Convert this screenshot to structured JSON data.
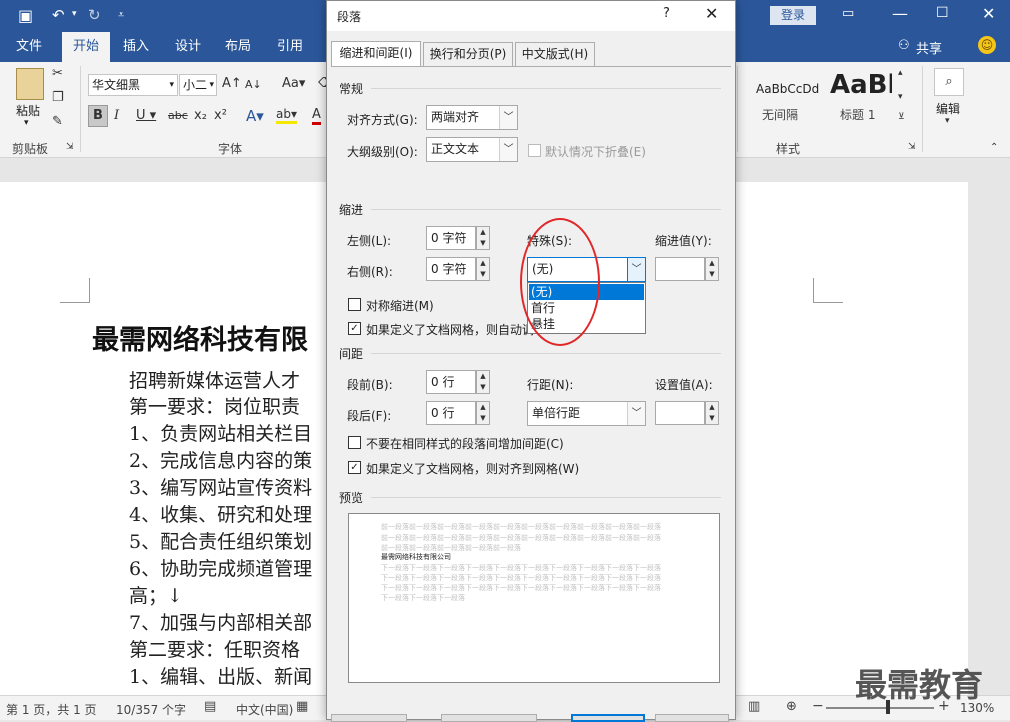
{
  "ribbon": {
    "tabs": [
      "文件",
      "开始",
      "插入",
      "设计",
      "布局",
      "引用"
    ],
    "login": "登录",
    "share": "共享",
    "font_name": "华文细黑",
    "font_size": "小二",
    "clipboard_label": "剪贴板",
    "font_group_label": "字体",
    "styles_label": "样式",
    "paste_label": "粘贴",
    "edit_label": "编辑",
    "style_nospacing_preview": "AaBbCcDd",
    "style_nospacing": "无间隔",
    "style_h1_preview": "AaBb",
    "style_h1": "标题 1"
  },
  "document": {
    "heading": "最需网络科技有限",
    "lines": [
      "招聘新媒体运营人才",
      "第一要求：岗位职责",
      "1、负责网站相关栏目",
      "2、完成信息内容的策",
      "3、编写网站宣传资料",
      "4、收集、研究和处理",
      "5、配合责任组织策划",
      "6、协助完成频道管理",
      "高；↓",
      "7、加强与内部相关部",
      "第二要求：任职资格",
      "1、编辑、出版、新闻"
    ]
  },
  "status": {
    "page": "第 1 页，共 1 页",
    "words": "10/357 个字",
    "lang": "中文(中国)",
    "zoom": "130%"
  },
  "dialog": {
    "title": "段落",
    "help": "?",
    "tabs": [
      "缩进和间距(I)",
      "换行和分页(P)",
      "中文版式(H)"
    ],
    "general": {
      "section": "常规",
      "align_label": "对齐方式(G):",
      "align_value": "两端对齐",
      "outline_label": "大纲级别(O):",
      "outline_value": "正文文本",
      "collapse_label": "默认情况下折叠(E)"
    },
    "indent": {
      "section": "缩进",
      "left_label": "左侧(L):",
      "left_value": "0 字符",
      "right_label": "右侧(R):",
      "right_value": "0 字符",
      "special_label": "特殊(S):",
      "special_value": "(无)",
      "special_options": [
        "(无)",
        "首行",
        "悬挂"
      ],
      "by_label": "缩进值(Y):",
      "mirror_label": "对称缩进(M)",
      "grid_label": "如果定义了文档网格，则自动调"
    },
    "spacing": {
      "section": "间距",
      "before_label": "段前(B):",
      "before_value": "0 行",
      "after_label": "段后(F):",
      "after_value": "0 行",
      "line_label": "行距(N):",
      "line_value": "单倍行距",
      "at_label": "设置值(A):",
      "no_space_label": "不要在相同样式的段落间增加间距(C)",
      "snap_label": "如果定义了文档网格，则对齐到网格(W)"
    },
    "preview": {
      "section": "预览",
      "prev_text": "前一段落前一段落前一段落前一段落前一段落前一段落前一段落前一段落前一段落前一段落",
      "prev_text2": "前一段落前一段落前一段落前一段落前一段落前一段落前一段落前一段落前一段落前一段落",
      "prev_text3": "前一段落前一段落前一段落前一段落前一段落",
      "sample": "最需网络科技有限公司",
      "next_text": "下一段落下一段落下一段落下一段落下一段落下一段落下一段落下一段落下一段落下一段落",
      "next_text2": "下一段落下一段落下一段落下一段落下一段落下一段落下一段落下一段落下一段落下一段落",
      "next_text3": "下一段落下一段落下一段落下一段落下一段落下一段落下一段落下一段落下一段落下一段落",
      "next_text4": "下一段落下一段落下一段落"
    }
  },
  "watermark": "最需教育",
  "colors": {
    "accent": "#2b579a",
    "highlight": "#0078d7",
    "annotation": "#e0282a"
  }
}
